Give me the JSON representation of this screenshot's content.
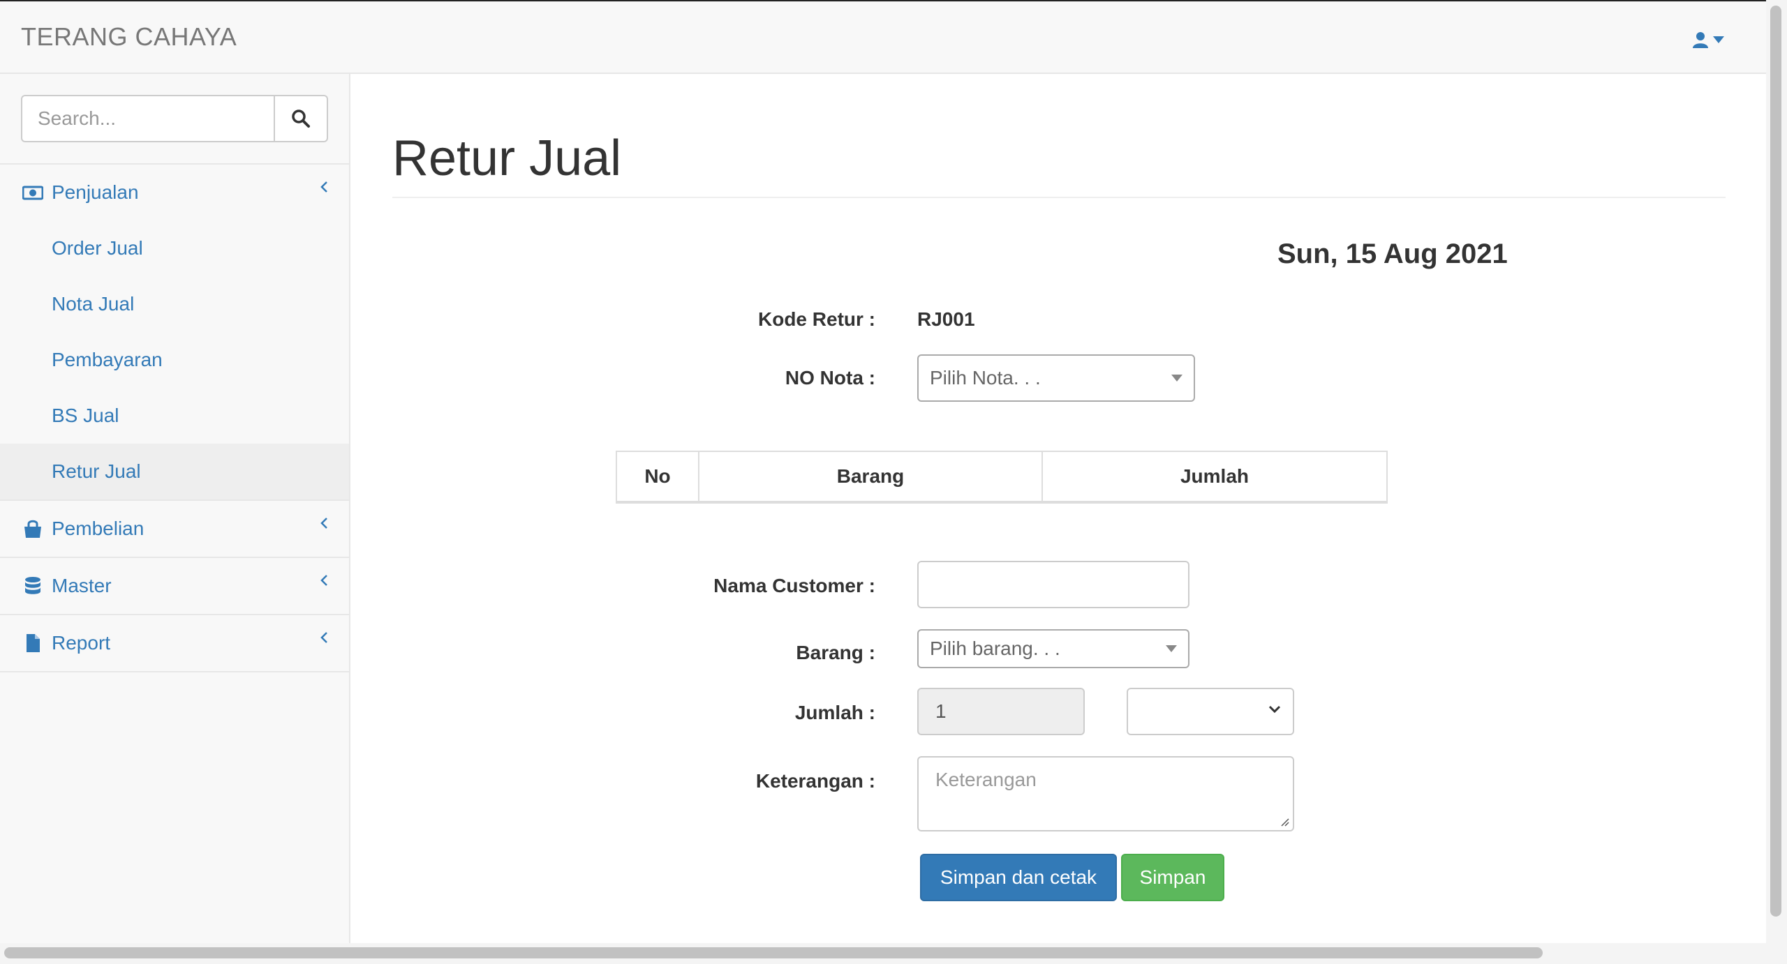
{
  "brand": "TERANG CAHAYA",
  "user_menu": {
    "icon": "user-icon",
    "caret": "caret-down-icon"
  },
  "search": {
    "placeholder": "Search...",
    "icon": "search-icon"
  },
  "sidebar": {
    "groups": [
      {
        "label": "Penjualan",
        "icon": "money-icon",
        "expanded": true,
        "items": [
          "Order Jual",
          "Nota Jual",
          "Pembayaran",
          "BS Jual",
          "Retur Jual"
        ],
        "active_item": "Retur Jual"
      },
      {
        "label": "Pembelian",
        "icon": "shopping-bag-icon",
        "expanded": false
      },
      {
        "label": "Master",
        "icon": "database-icon",
        "expanded": false
      },
      {
        "label": "Report",
        "icon": "file-icon",
        "expanded": false
      }
    ]
  },
  "page": {
    "title": "Retur Jual",
    "date": "Sun, 15 Aug 2021"
  },
  "form": {
    "kode_retur_label": "Kode Retur :",
    "kode_retur_value": "RJ001",
    "no_nota_label": "NO Nota :",
    "no_nota_placeholder": "Pilih Nota. . .",
    "table_headers": [
      "No",
      "Barang",
      "Jumlah"
    ],
    "nama_customer_label": "Nama Customer :",
    "nama_customer_value": "",
    "barang_label": "Barang :",
    "barang_placeholder": "Pilih barang. . .",
    "jumlah_label": "Jumlah :",
    "jumlah_value": "1",
    "keterangan_label": "Keterangan :",
    "keterangan_placeholder": "Keterangan",
    "btn_simpan_cetak": "Simpan dan cetak",
    "btn_simpan": "Simpan"
  },
  "colors": {
    "link": "#337ab7",
    "primary": "#337ab7",
    "success": "#5cb85c"
  }
}
